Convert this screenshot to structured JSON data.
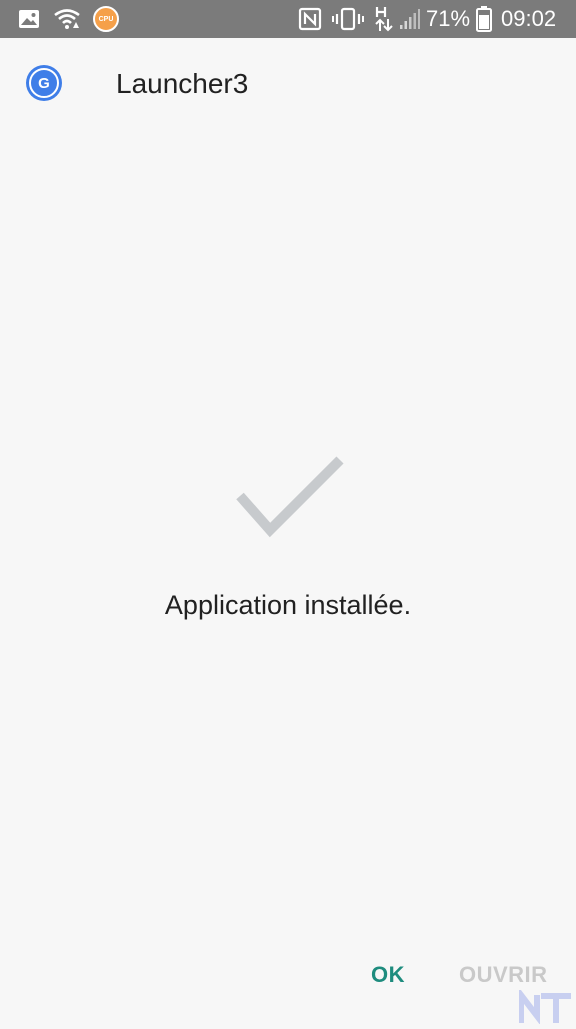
{
  "status_bar": {
    "battery_percent": "71%",
    "time": "09:02",
    "cpu_badge": "CPU",
    "icons": [
      "image-icon",
      "wifi-icon",
      "cpu-badge-icon",
      "nfc-icon",
      "vibrate-icon",
      "data-transfer-icon",
      "signal-icon",
      "battery-icon"
    ]
  },
  "header": {
    "app_icon_letter": "G",
    "title": "Launcher3"
  },
  "main": {
    "message": "Application installée."
  },
  "actions": {
    "ok_label": "OK",
    "open_label": "OUVRIR"
  },
  "colors": {
    "status_bar": "#7b7b7b",
    "background": "#f7f7f7",
    "accent": "#1e8c7e",
    "disabled": "#c9c9c9",
    "check": "#c7cacd"
  },
  "watermark": "NT"
}
